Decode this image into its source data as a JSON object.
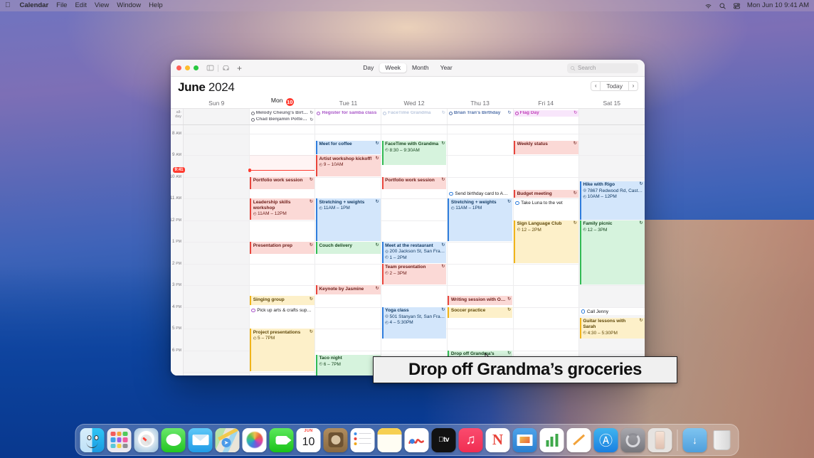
{
  "menubar": {
    "apple": "apple-logo",
    "items": [
      "Calendar",
      "File",
      "Edit",
      "View",
      "Window",
      "Help"
    ],
    "app_name": "Calendar",
    "status_icons": [
      "wifi-icon",
      "search-icon",
      "control-center-icon"
    ],
    "clock": "Mon Jun 10  9:41 AM"
  },
  "window": {
    "toolbar": {
      "sidebar_icon": "sidebar-toggle-icon",
      "inbox_icon": "inbox-icon",
      "add_icon": "+",
      "views": [
        {
          "label": "Day",
          "active": false
        },
        {
          "label": "Week",
          "active": true
        },
        {
          "label": "Month",
          "active": false
        },
        {
          "label": "Year",
          "active": false
        }
      ],
      "search_placeholder": "Search",
      "search_icon": "search-icon"
    },
    "title": {
      "month": "June",
      "year": "2024"
    },
    "nav": {
      "prev": "‹",
      "today": "Today",
      "next": "›"
    },
    "allday_label": "all-day",
    "days": [
      {
        "name": "Sun",
        "num": "9",
        "today": false,
        "dim": true
      },
      {
        "name": "Mon",
        "num": "10",
        "today": true,
        "dim": false
      },
      {
        "name": "Tue",
        "num": "11",
        "today": false,
        "dim": false
      },
      {
        "name": "Wed",
        "num": "12",
        "today": false,
        "dim": false
      },
      {
        "name": "Thu",
        "num": "13",
        "today": false,
        "dim": false
      },
      {
        "name": "Fri",
        "num": "14",
        "today": false,
        "dim": false
      },
      {
        "name": "Sat",
        "num": "15",
        "today": false,
        "dim": true
      }
    ],
    "hours": [
      {
        "h": "8",
        "ap": "AM"
      },
      {
        "h": "9",
        "ap": "AM"
      },
      {
        "h": "10",
        "ap": "AM"
      },
      {
        "h": "11",
        "ap": "AM"
      },
      {
        "h": "12",
        "ap": "PM"
      },
      {
        "h": "1",
        "ap": "PM"
      },
      {
        "h": "2",
        "ap": "PM"
      },
      {
        "h": "3",
        "ap": "PM"
      },
      {
        "h": "4",
        "ap": "PM"
      },
      {
        "h": "5",
        "ap": "PM"
      },
      {
        "h": "6",
        "ap": "PM"
      }
    ],
    "now": {
      "badge": "9:41",
      "hour": 9.683
    },
    "allday_events": [
      {
        "col": 1,
        "title": "Melody Cheung's Birt…",
        "color": "#6e6e78",
        "bg": "#ffffff",
        "repeat": true,
        "kind": "ring"
      },
      {
        "col": 1,
        "title": "Chad Benjamin Potter…",
        "color": "#6e6e78",
        "bg": "#ffffff",
        "repeat": true,
        "kind": "ring"
      },
      {
        "col": 2,
        "title": "Register for samba class",
        "color": "#a855c8",
        "bg": "#ffffff",
        "repeat": false,
        "kind": "ring"
      },
      {
        "col": 3,
        "title": "FaceTime Grandma",
        "color": "#b9c6dd",
        "bg": "#ffffff",
        "repeat": true,
        "kind": "ring",
        "dim": true
      },
      {
        "col": 4,
        "title": "Brian Tran's Birthday",
        "color": "#4f6fa8",
        "bg": "#ffffff",
        "repeat": true,
        "kind": "ring"
      },
      {
        "col": 5,
        "title": "Flag Day",
        "color": "#c13fb9",
        "bg": "#f8e6fb",
        "repeat": true,
        "kind": "ring"
      }
    ],
    "events": [
      {
        "col": 2,
        "title": "Meet for coffee",
        "start": 8.33,
        "end": 9.0,
        "accent": "#2f7ddc",
        "bg": "#d3e6fb",
        "fg": "#123a63",
        "repeat": true
      },
      {
        "col": 3,
        "title": "FaceTime with Grandma",
        "time": "8:30 – 9:30AM",
        "start": 8.33,
        "end": 9.5,
        "accent": "#32ba54",
        "bg": "#d6f3dd",
        "fg": "#17471f",
        "repeat": true,
        "clock": true
      },
      {
        "col": 5,
        "title": "Weekly status",
        "start": 8.33,
        "end": 9.0,
        "accent": "#e8453c",
        "bg": "#fbd9d6",
        "fg": "#6b1a16",
        "repeat": true
      },
      {
        "col": 2,
        "title": "Artist workshop kickoff!",
        "time": "9 – 10AM",
        "start": 9.0,
        "end": 10.0,
        "accent": "#e8453c",
        "bg": "#fbd9d6",
        "fg": "#6b1a16",
        "repeat": true,
        "clock": true
      },
      {
        "col": 1,
        "title": "Portfolio work session",
        "start": 10.0,
        "end": 10.6,
        "accent": "#e8453c",
        "bg": "#fbd9d6",
        "fg": "#6b1a16",
        "repeat": true
      },
      {
        "col": 3,
        "title": "Portfolio work session",
        "start": 10.0,
        "end": 10.6,
        "accent": "#e8453c",
        "bg": "#fbd9d6",
        "fg": "#6b1a16",
        "repeat": true
      },
      {
        "col": 6,
        "title": "Hike with Rigo",
        "place": "7867 Redwood Rd, Castr…",
        "time": "10AM – 12PM",
        "start": 10.2,
        "end": 12.0,
        "accent": "#2f7ddc",
        "bg": "#d3e6fb",
        "fg": "#123a63",
        "repeat": true,
        "clock": true
      },
      {
        "col": 5,
        "title": "Budget meeting",
        "start": 10.6,
        "end": 11.0,
        "accent": "#e8453c",
        "bg": "#fbd9d6",
        "fg": "#6b1a16",
        "repeat": true
      },
      {
        "col": 1,
        "title": "Leadership skills workshop",
        "time": "11AM – 12PM",
        "start": 11.0,
        "end": 12.0,
        "accent": "#e8453c",
        "bg": "#fbd9d6",
        "fg": "#6b1a16",
        "repeat": true,
        "clock": true,
        "wrap": true
      },
      {
        "col": 2,
        "title": "Stretching + weights",
        "time": "11AM – 1PM",
        "start": 11.0,
        "end": 13.0,
        "accent": "#2f7ddc",
        "bg": "#d3e6fb",
        "fg": "#123a63",
        "repeat": true,
        "clock": true
      },
      {
        "col": 4,
        "title": "Stretching + weights",
        "time": "11AM – 1PM",
        "start": 11.0,
        "end": 13.0,
        "accent": "#2f7ddc",
        "bg": "#d3e6fb",
        "fg": "#123a63",
        "repeat": true,
        "clock": true
      },
      {
        "col": 5,
        "title": "Sign Language Club",
        "time": "12 – 2PM",
        "start": 12.0,
        "end": 14.0,
        "accent": "#f0b419",
        "bg": "#fdf0c9",
        "fg": "#5e4708",
        "repeat": true,
        "clock": true
      },
      {
        "col": 6,
        "title": "Family picnic",
        "time": "12 – 3PM",
        "start": 12.0,
        "end": 15.0,
        "accent": "#32ba54",
        "bg": "#d6f3dd",
        "fg": "#17471f",
        "repeat": true,
        "clock": true
      },
      {
        "col": 1,
        "title": "Presentation prep",
        "start": 13.0,
        "end": 13.6,
        "accent": "#e8453c",
        "bg": "#fbd9d6",
        "fg": "#6b1a16",
        "repeat": true
      },
      {
        "col": 2,
        "title": "Couch delivery",
        "start": 13.0,
        "end": 13.6,
        "accent": "#32ba54",
        "bg": "#d6f3dd",
        "fg": "#17471f",
        "repeat": true
      },
      {
        "col": 3,
        "title": "Meet at the restaurant",
        "place": "200 Jackson St, San Fran…",
        "time": "1 – 2PM",
        "start": 13.0,
        "end": 14.0,
        "accent": "#2f7ddc",
        "bg": "#d3e6fb",
        "fg": "#123a63",
        "repeat": true,
        "clock": true
      },
      {
        "col": 3,
        "title": "Team presentation",
        "time": "2 – 3PM",
        "start": 14.0,
        "end": 15.0,
        "accent": "#e8453c",
        "bg": "#fbd9d6",
        "fg": "#6b1a16",
        "repeat": true,
        "clock": true
      },
      {
        "col": 2,
        "title": "Keynote by Jasmine",
        "start": 15.0,
        "end": 15.45,
        "accent": "#e8453c",
        "bg": "#fbd9d6",
        "fg": "#6b1a16",
        "repeat": true
      },
      {
        "col": 1,
        "title": "Singing group",
        "start": 15.5,
        "end": 15.95,
        "accent": "#f0b419",
        "bg": "#fdf0c9",
        "fg": "#5e4708",
        "repeat": true
      },
      {
        "col": 4,
        "title": "Writing session with Or…",
        "start": 15.5,
        "end": 15.95,
        "accent": "#e8453c",
        "bg": "#fbd9d6",
        "fg": "#6b1a16",
        "repeat": true
      },
      {
        "col": 3,
        "title": "Yoga class",
        "place": "501 Stanyan St, San Fran…",
        "time": "4 – 5:30PM",
        "start": 16.0,
        "end": 17.5,
        "accent": "#2f7ddc",
        "bg": "#d3e6fb",
        "fg": "#123a63",
        "repeat": true,
        "clock": true
      },
      {
        "col": 4,
        "title": "Soccer practice",
        "start": 16.0,
        "end": 16.55,
        "accent": "#f0b419",
        "bg": "#fdf0c9",
        "fg": "#5e4708",
        "repeat": true
      },
      {
        "col": 6,
        "title": "Guitar lessons with Sarah",
        "time": "4:30 – 5:30PM",
        "start": 16.5,
        "end": 17.5,
        "accent": "#f0b419",
        "bg": "#fdf0c9",
        "fg": "#5e4708",
        "repeat": true,
        "clock": true,
        "wrap": true
      },
      {
        "col": 1,
        "title": "Project presentations",
        "time": "5 – 7PM",
        "start": 17.0,
        "end": 19.0,
        "accent": "#f0b419",
        "bg": "#fdf0c9",
        "fg": "#5e4708",
        "repeat": true,
        "clock": true
      },
      {
        "col": 4,
        "title": "Drop off Grandma's groceries",
        "start": 18.0,
        "end": 18.7,
        "accent": "#32ba54",
        "bg": "#d6f3dd",
        "fg": "#17471f",
        "repeat": true,
        "wrap": true
      },
      {
        "col": 2,
        "title": "Taco night",
        "time": "6 – 7PM",
        "start": 18.2,
        "end": 19.2,
        "accent": "#32ba54",
        "bg": "#d6f3dd",
        "fg": "#17471f",
        "repeat": false,
        "clock": true
      }
    ],
    "reminders": [
      {
        "col": 4,
        "title": "Send birthday card to A…",
        "at": 10.62,
        "color": "#2f7ddc"
      },
      {
        "col": 5,
        "title": "Take Luna to the vet",
        "at": 11.05,
        "color": "#2f7ddc"
      },
      {
        "col": 1,
        "title": "Pick up arts & crafts sup…",
        "at": 16.0,
        "color": "#a855c8"
      },
      {
        "col": 6,
        "title": "Call Jenny",
        "at": 16.05,
        "color": "#2f7ddc"
      }
    ]
  },
  "callout": {
    "text": "Drop off Grandma’s groceries"
  },
  "dock": {
    "apps": [
      {
        "name": "finder",
        "running": true
      },
      {
        "name": "launchpad",
        "running": false
      },
      {
        "name": "safari",
        "running": false
      },
      {
        "name": "messages",
        "running": false
      },
      {
        "name": "mail",
        "running": false
      },
      {
        "name": "maps",
        "running": false
      },
      {
        "name": "photos",
        "running": false
      },
      {
        "name": "facetime",
        "running": false
      },
      {
        "name": "calendar",
        "running": true,
        "month": "JUN",
        "day": "10"
      },
      {
        "name": "contacts",
        "running": false
      },
      {
        "name": "reminders",
        "running": false
      },
      {
        "name": "notes",
        "running": false
      },
      {
        "name": "freeform",
        "running": false
      },
      {
        "name": "appletv",
        "running": false
      },
      {
        "name": "music",
        "running": false
      },
      {
        "name": "news",
        "running": false
      },
      {
        "name": "keynote",
        "running": false
      },
      {
        "name": "numbers",
        "running": false
      },
      {
        "name": "pages",
        "running": false
      },
      {
        "name": "appstore",
        "running": false
      },
      {
        "name": "settings",
        "running": false
      },
      {
        "name": "iphone-mirroring",
        "running": false
      }
    ],
    "folder": "downloads-folder",
    "trash": "trash"
  }
}
